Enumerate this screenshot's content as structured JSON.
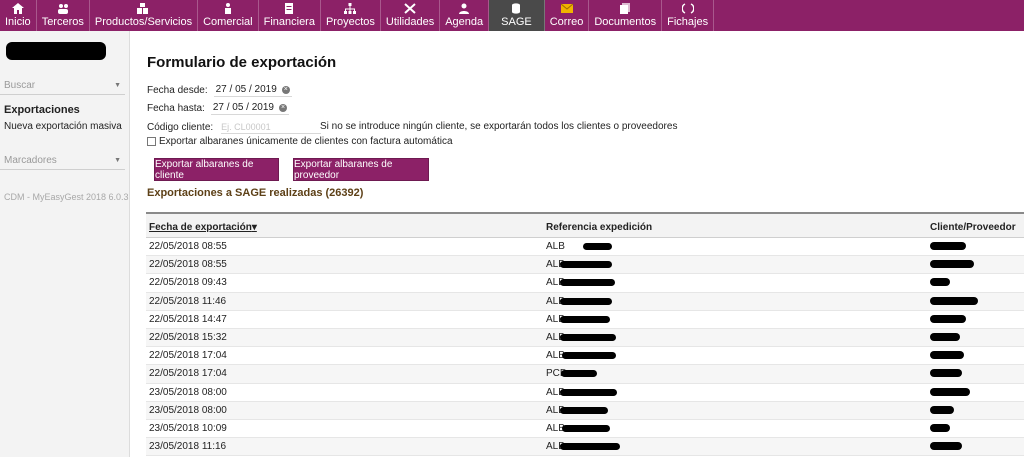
{
  "nav": [
    {
      "label": "Inicio",
      "icon": "home-icon"
    },
    {
      "label": "Terceros",
      "icon": "users-icon"
    },
    {
      "label": "Productos/Servicios",
      "icon": "boxes-icon"
    },
    {
      "label": "Comercial",
      "icon": "salesman-icon"
    },
    {
      "label": "Financiera",
      "icon": "document-icon"
    },
    {
      "label": "Proyectos",
      "icon": "network-icon"
    },
    {
      "label": "Utilidades",
      "icon": "tools-icon"
    },
    {
      "label": "Agenda",
      "icon": "person-icon"
    },
    {
      "label": "SAGE",
      "icon": "database-icon",
      "active": true
    },
    {
      "label": "Correo",
      "icon": "envelope-icon"
    },
    {
      "label": "Documentos",
      "icon": "documents-icon"
    },
    {
      "label": "Fichajes",
      "icon": "clock-icon"
    }
  ],
  "sidebar": {
    "search_label": "Buscar",
    "section_title": "Exportaciones",
    "link": "Nueva exportación masiva",
    "bookmarks_label": "Marcadores",
    "version": "CDM - MyEasyGest 2018 6.0.3"
  },
  "form": {
    "title": "Formulario de exportación",
    "date_from_label": "Fecha desde:",
    "date_from_value": "27 / 05 / 2019",
    "date_to_label": "Fecha hasta:",
    "date_to_value": "27 / 05 / 2019",
    "client_label": "Código cliente:",
    "client_placeholder": "Ej. CL00001",
    "client_hint": "Si no se introduce ningún cliente, se exportarán todos los clientes o proveedores",
    "checkbox_label": "Exportar albaranes únicamente de clientes con factura automática",
    "btn_client": "Exportar albaranes de cliente",
    "btn_supplier": "Exportar albaranes de proveedor"
  },
  "exports": {
    "heading": "Exportaciones a SAGE realizadas (26392)",
    "columns": [
      "Fecha de exportación",
      "Referencia expedición",
      "Cliente/Proveedor"
    ],
    "rows": [
      {
        "date": "22/05/2018 08:55",
        "ref": "ALB"
      },
      {
        "date": "22/05/2018 08:55",
        "ref": "ALB"
      },
      {
        "date": "22/05/2018 09:43",
        "ref": "ALB"
      },
      {
        "date": "22/05/2018 11:46",
        "ref": "ALB"
      },
      {
        "date": "22/05/2018 14:47",
        "ref": "ALB"
      },
      {
        "date": "22/05/2018 15:32",
        "ref": "ALB"
      },
      {
        "date": "22/05/2018 17:04",
        "ref": "ALB"
      },
      {
        "date": "22/05/2018 17:04",
        "ref": "PCD"
      },
      {
        "date": "23/05/2018 08:00",
        "ref": "ALB"
      },
      {
        "date": "23/05/2018 08:00",
        "ref": "ALB"
      },
      {
        "date": "23/05/2018 10:09",
        "ref": "ALB"
      },
      {
        "date": "23/05/2018 11:16",
        "ref": "ALB"
      }
    ]
  }
}
